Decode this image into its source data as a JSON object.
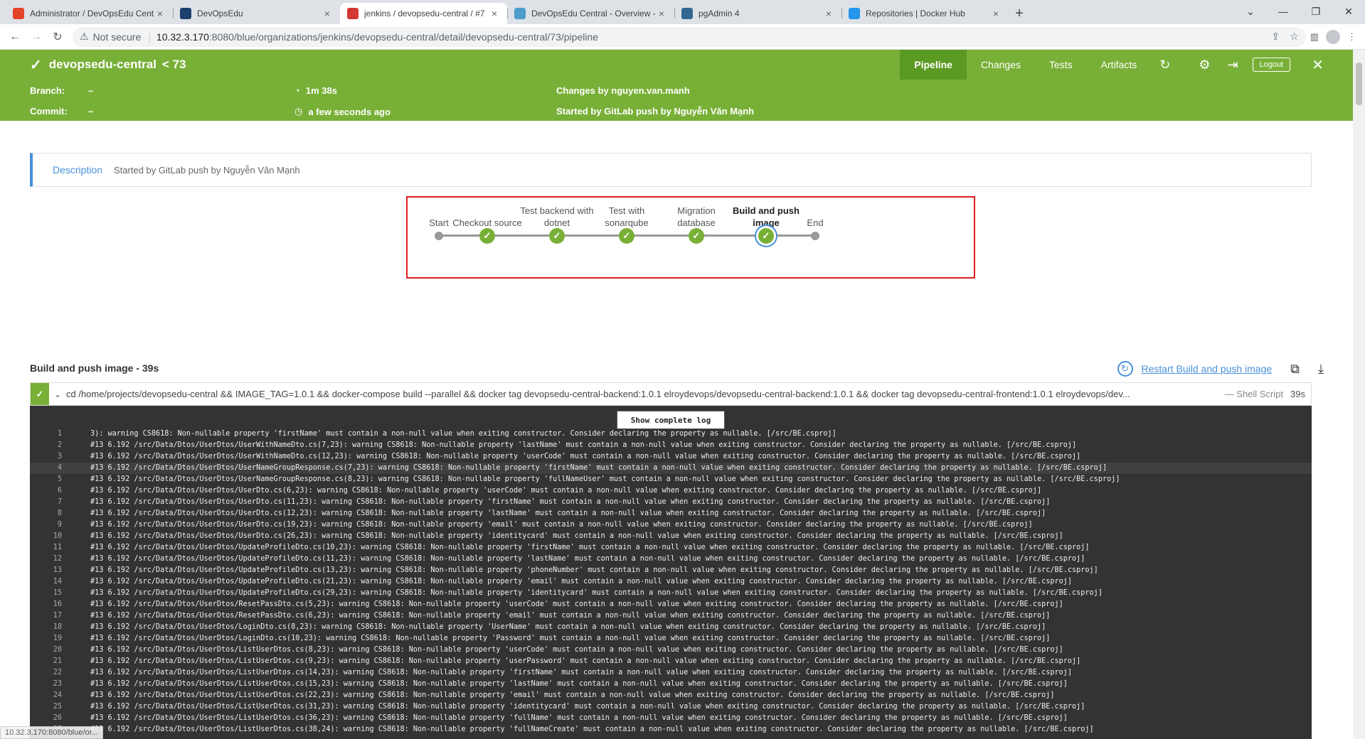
{
  "browser": {
    "tabs": [
      {
        "title": "Administrator / DevOpsEdu Cent",
        "favicon_color": "#e24329",
        "favicon": "gitlab-icon",
        "active": false
      },
      {
        "title": "DevOpsEdu",
        "favicon_color": "#1c3f6e",
        "favicon": "devopsedu-icon",
        "active": false
      },
      {
        "title": "jenkins / devopsedu-central / #7",
        "favicon_color": "#d33833",
        "favicon": "jenkins-icon",
        "active": true
      },
      {
        "title": "DevOpsEdu Central - Overview -",
        "favicon_color": "#4e9bcd",
        "favicon": "sonarqube-icon",
        "active": false
      },
      {
        "title": "pgAdmin 4",
        "favicon_color": "#336791",
        "favicon": "pgadmin-icon",
        "active": false
      },
      {
        "title": "Repositories | Docker Hub",
        "favicon_color": "#2496ed",
        "favicon": "dockerhub-icon",
        "active": false
      }
    ],
    "not_secure": "Not secure",
    "url_host": "10.32.3.170",
    "url_rest": ":8080/blue/organizations/jenkins/devopsedu-central/detail/devopsedu-central/73/pipeline",
    "status_url": "10.32.3.170:8080/blue/or..."
  },
  "header": {
    "title": "devopsedu-central",
    "run": "< 73",
    "nav": [
      "Pipeline",
      "Changes",
      "Tests",
      "Artifacts"
    ],
    "selected_nav": "Pipeline",
    "logout": "Logout",
    "accent": "#78b037"
  },
  "info": {
    "branch_label": "Branch:",
    "branch_value": "–",
    "commit_label": "Commit:",
    "commit_value": "–",
    "duration": "1m 38s",
    "finished": "a few seconds ago",
    "changes": "Changes by nguyen.van.manh",
    "started": "Started by GitLab push by Nguyễn Văn Mạnh"
  },
  "description": {
    "label": "Description",
    "text": "Started by GitLab push by Nguyễn Văn Mạnh"
  },
  "pipeline": {
    "stages": [
      {
        "l1": "",
        "l2": "Start",
        "kind": "start"
      },
      {
        "l1": "",
        "l2": "Checkout source",
        "kind": "ok"
      },
      {
        "l1": "Test backend with",
        "l2": "dotnet",
        "kind": "ok"
      },
      {
        "l1": "Test with",
        "l2": "sonarqube",
        "kind": "ok"
      },
      {
        "l1": "Migration",
        "l2": "database",
        "kind": "ok"
      },
      {
        "l1": "Build and push",
        "l2": "image",
        "kind": "selected"
      },
      {
        "l1": "",
        "l2": "End",
        "kind": "end"
      }
    ]
  },
  "step": {
    "title": "Build and push image - 39s",
    "restart": "Restart Build and push image",
    "command": "cd /home/projects/devopsedu-central && IMAGE_TAG=1.0.1 && docker-compose build --parallel && docker tag devopsedu-central-backend:1.0.1 elroydevops/devopsedu-central-backend:1.0.1 && docker tag devopsedu-central-frontend:1.0.1 elroydevops/dev...",
    "type": "— Shell Script",
    "duration": "39s"
  },
  "log": {
    "show_complete": "Show complete log",
    "highlighted_line": 4,
    "lines": [
      "3): warning CS8618: Non-nullable property 'firstName' must contain a non-null value when exiting constructor. Consider declaring the property as nullable. [/src/BE.csproj]",
      "#13 6.192 /src/Data/Dtos/UserDtos/UserWithNameDto.cs(7,23): warning CS8618: Non-nullable property 'lastName' must contain a non-null value when exiting constructor. Consider declaring the property as nullable. [/src/BE.csproj]",
      "#13 6.192 /src/Data/Dtos/UserDtos/UserWithNameDto.cs(12,23): warning CS8618: Non-nullable property 'userCode' must contain a non-null value when exiting constructor. Consider declaring the property as nullable. [/src/BE.csproj]",
      "#13 6.192 /src/Data/Dtos/UserDtos/UserNameGroupResponse.cs(7,23): warning CS8618: Non-nullable property 'firstName' must contain a non-null value when exiting constructor. Consider declaring the property as nullable. [/src/BE.csproj]",
      "#13 6.192 /src/Data/Dtos/UserDtos/UserNameGroupResponse.cs(8,23): warning CS8618: Non-nullable property 'fullNameUser' must contain a non-null value when exiting constructor. Consider declaring the property as nullable. [/src/BE.csproj]",
      "#13 6.192 /src/Data/Dtos/UserDtos/UserDto.cs(6,23): warning CS8618: Non-nullable property 'userCode' must contain a non-null value when exiting constructor. Consider declaring the property as nullable. [/src/BE.csproj]",
      "#13 6.192 /src/Data/Dtos/UserDtos/UserDto.cs(11,23): warning CS8618: Non-nullable property 'firstName' must contain a non-null value when exiting constructor. Consider declaring the property as nullable. [/src/BE.csproj]",
      "#13 6.192 /src/Data/Dtos/UserDtos/UserDto.cs(12,23): warning CS8618: Non-nullable property 'lastName' must contain a non-null value when exiting constructor. Consider declaring the property as nullable. [/src/BE.csproj]",
      "#13 6.192 /src/Data/Dtos/UserDtos/UserDto.cs(19,23): warning CS8618: Non-nullable property 'email' must contain a non-null value when exiting constructor. Consider declaring the property as nullable. [/src/BE.csproj]",
      "#13 6.192 /src/Data/Dtos/UserDtos/UserDto.cs(26,23): warning CS8618: Non-nullable property 'identitycard' must contain a non-null value when exiting constructor. Consider declaring the property as nullable. [/src/BE.csproj]",
      "#13 6.192 /src/Data/Dtos/UserDtos/UpdateProfileDto.cs(10,23): warning CS8618: Non-nullable property 'firstName' must contain a non-null value when exiting constructor. Consider declaring the property as nullable. [/src/BE.csproj]",
      "#13 6.192 /src/Data/Dtos/UserDtos/UpdateProfileDto.cs(11,23): warning CS8618: Non-nullable property 'lastName' must contain a non-null value when exiting constructor. Consider declaring the property as nullable. [/src/BE.csproj]",
      "#13 6.192 /src/Data/Dtos/UserDtos/UpdateProfileDto.cs(13,23): warning CS8618: Non-nullable property 'phoneNumber' must contain a non-null value when exiting constructor. Consider declaring the property as nullable. [/src/BE.csproj]",
      "#13 6.192 /src/Data/Dtos/UserDtos/UpdateProfileDto.cs(21,23): warning CS8618: Non-nullable property 'email' must contain a non-null value when exiting constructor. Consider declaring the property as nullable. [/src/BE.csproj]",
      "#13 6.192 /src/Data/Dtos/UserDtos/UpdateProfileDto.cs(29,23): warning CS8618: Non-nullable property 'identitycard' must contain a non-null value when exiting constructor. Consider declaring the property as nullable. [/src/BE.csproj]",
      "#13 6.192 /src/Data/Dtos/UserDtos/ResetPassDto.cs(5,23): warning CS8618: Non-nullable property 'userCode' must contain a non-null value when exiting constructor. Consider declaring the property as nullable. [/src/BE.csproj]",
      "#13 6.192 /src/Data/Dtos/UserDtos/ResetPassDto.cs(6,23): warning CS8618: Non-nullable property 'email' must contain a non-null value when exiting constructor. Consider declaring the property as nullable. [/src/BE.csproj]",
      "#13 6.192 /src/Data/Dtos/UserDtos/LoginDto.cs(8,23): warning CS8618: Non-nullable property 'UserName' must contain a non-null value when exiting constructor. Consider declaring the property as nullable. [/src/BE.csproj]",
      "#13 6.192 /src/Data/Dtos/UserDtos/LoginDto.cs(10,23): warning CS8618: Non-nullable property 'Password' must contain a non-null value when exiting constructor. Consider declaring the property as nullable. [/src/BE.csproj]",
      "#13 6.192 /src/Data/Dtos/UserDtos/ListUserDtos.cs(8,23): warning CS8618: Non-nullable property 'userCode' must contain a non-null value when exiting constructor. Consider declaring the property as nullable. [/src/BE.csproj]",
      "#13 6.192 /src/Data/Dtos/UserDtos/ListUserDtos.cs(9,23): warning CS8618: Non-nullable property 'userPassword' must contain a non-null value when exiting constructor. Consider declaring the property as nullable. [/src/BE.csproj]",
      "#13 6.192 /src/Data/Dtos/UserDtos/ListUserDtos.cs(14,23): warning CS8618: Non-nullable property 'firstName' must contain a non-null value when exiting constructor. Consider declaring the property as nullable. [/src/BE.csproj]",
      "#13 6.192 /src/Data/Dtos/UserDtos/ListUserDtos.cs(15,23): warning CS8618: Non-nullable property 'lastName' must contain a non-null value when exiting constructor. Consider declaring the property as nullable. [/src/BE.csproj]",
      "#13 6.192 /src/Data/Dtos/UserDtos/ListUserDtos.cs(22,23): warning CS8618: Non-nullable property 'email' must contain a non-null value when exiting constructor. Consider declaring the property as nullable. [/src/BE.csproj]",
      "#13 6.192 /src/Data/Dtos/UserDtos/ListUserDtos.cs(31,23): warning CS8618: Non-nullable property 'identitycard' must contain a non-null value when exiting constructor. Consider declaring the property as nullable. [/src/BE.csproj]",
      "#13 6.192 /src/Data/Dtos/UserDtos/ListUserDtos.cs(36,23): warning CS8618: Non-nullable property 'fullName' must contain a non-null value when exiting constructor. Consider declaring the property as nullable. [/src/BE.csproj]",
      "#13 6.192 /src/Data/Dtos/UserDtos/ListUserDtos.cs(38,24): warning CS8618: Non-nullable property 'fullNameCreate' must contain a non-null value when exiting constructor. Consider declaring the property as nullable. [/src/BE.csproj]"
    ]
  }
}
